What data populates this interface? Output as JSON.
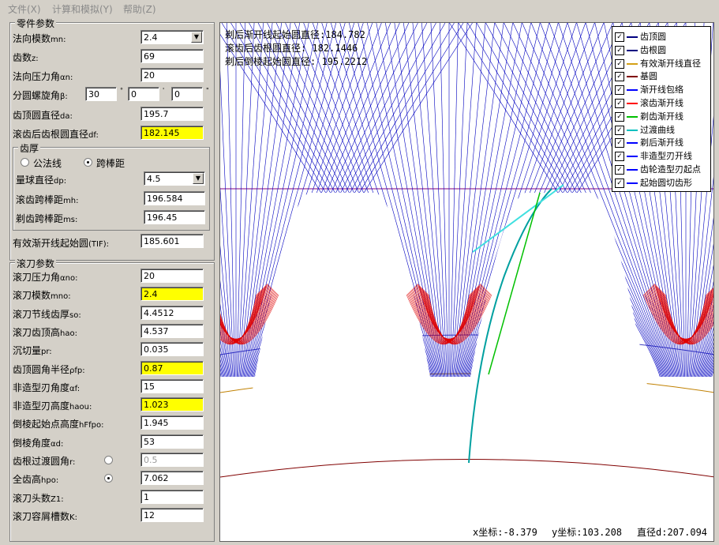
{
  "menu": [
    "文件(X)",
    "计算和模拟(Y)",
    "帮助(Z)"
  ],
  "part": {
    "title": "零件参数",
    "rows": [
      {
        "label": "法向模数",
        "sub": "mn:",
        "value": "2.4",
        "combo": true
      },
      {
        "label": "齿数",
        "sub": "z:",
        "value": "69"
      },
      {
        "label": "法向压力角",
        "sub": "αn:",
        "value": "20"
      },
      {
        "label": "齿顶圆直径",
        "sub": "da:",
        "value": "195.7"
      },
      {
        "label": "滚齿后齿根圆直径",
        "sub": "df:",
        "value": "182.145",
        "yellow": true
      }
    ],
    "helix": {
      "label": "分圆螺旋角",
      "sub": "β:",
      "deg": "30",
      "min": "0",
      "sec": "0",
      "deg_mark": "°",
      "min_mark": "'",
      "sec_mark": "\""
    },
    "thickness": {
      "title": "齿厚",
      "opt1": "公法线",
      "opt2": "跨棒距",
      "rows": [
        {
          "label": "量球直径",
          "sub": "dp:",
          "value": "4.5",
          "combo": true
        },
        {
          "label": "滚齿跨棒距",
          "sub": "mh:",
          "value": "196.584"
        },
        {
          "label": "剃齿跨棒距",
          "sub": "ms:",
          "value": "196.45"
        }
      ]
    },
    "tif": {
      "label": "有效渐开线起始圆",
      "sub": "(TIF):",
      "value": "185.601"
    }
  },
  "hob": {
    "title": "滚刀参数",
    "rows": [
      {
        "label": "滚刀压力角",
        "sub": "αno:",
        "value": "20"
      },
      {
        "label": "滚刀模数",
        "sub": "mno:",
        "value": "2.4",
        "yellow": true
      },
      {
        "label": "滚刀节线齿厚",
        "sub": "so:",
        "value": "4.4512"
      },
      {
        "label": "滚刀齿顶高",
        "sub": "hao:",
        "value": "4.537"
      },
      {
        "label": "沉切量",
        "sub": "pr:",
        "value": "0.035"
      },
      {
        "label": "齿顶圆角半径",
        "sub": "ρfp:",
        "value": "0.87",
        "yellow": true
      },
      {
        "label": "非造型刃角度",
        "sub": "αf:",
        "value": "15"
      },
      {
        "label": "非造型刃高度",
        "sub": "haou:",
        "value": "1.023",
        "yellow": true
      },
      {
        "label": "倒棱起始点高度",
        "sub": "hFfpo:",
        "value": "1.945"
      },
      {
        "label": "倒棱角度",
        "sub": "αd:",
        "value": "53"
      },
      {
        "label": "齿根过渡圆角",
        "sub": "r:",
        "value": "0.5",
        "radio": false,
        "gray": true
      },
      {
        "label": "全齿高",
        "sub": "hpo:",
        "value": "7.062",
        "radio": true
      },
      {
        "label": "滚刀头数",
        "sub": "Z1:",
        "value": "1"
      },
      {
        "label": "滚刀容屑槽数",
        "sub": "K:",
        "value": "12"
      }
    ]
  },
  "plot": {
    "info": [
      {
        "label": "剃后渐开线起始圆直径:",
        "value": "184.782"
      },
      {
        "label": "滚齿后齿根圆直径:",
        "value": "182.1446"
      },
      {
        "label": "剃后倒棱起始圆直径:",
        "value": "195.2212"
      }
    ],
    "legend": [
      {
        "label": "齿顶圆",
        "color": "#000080"
      },
      {
        "label": "齿根圆",
        "color": "#000080"
      },
      {
        "label": "有效渐开线直径",
        "color": "#d4a017"
      },
      {
        "label": "基圆",
        "color": "#800000"
      },
      {
        "label": "渐开线包络",
        "color": "#0000ff"
      },
      {
        "label": "滚齿渐开线",
        "color": "#ff0000"
      },
      {
        "label": "剃齿渐开线",
        "color": "#00c000"
      },
      {
        "label": "过渡曲线",
        "color": "#00c0c0"
      },
      {
        "label": "剃后渐开线",
        "color": "#0000ff"
      },
      {
        "label": "非造型刃开线",
        "color": "#0000ff"
      },
      {
        "label": "齿轮造型刃起点",
        "color": "#0000ff"
      },
      {
        "label": "起始圆切齿形",
        "color": "#0000ff"
      }
    ],
    "status": {
      "x": "x坐标:-8.379",
      "y": "y坐标:103.208",
      "d": "直径d:207.094"
    }
  }
}
